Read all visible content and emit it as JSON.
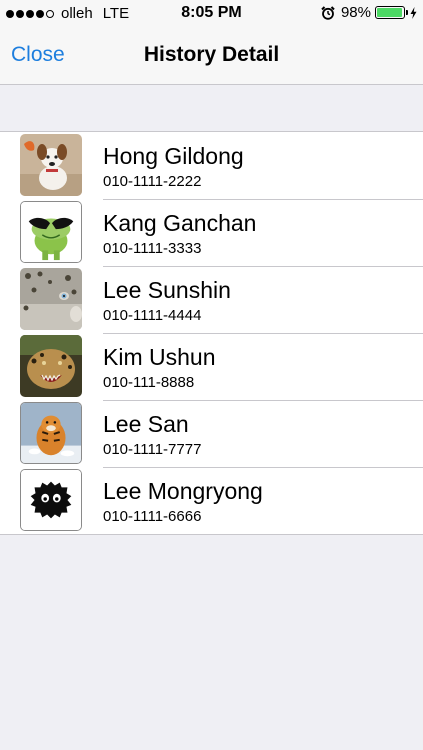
{
  "status_bar": {
    "carrier": "olleh",
    "network": "LTE",
    "signal_bars": 4,
    "signal_max": 5,
    "time": "8:05 PM",
    "battery_percent_text": "98%",
    "battery_level": 0.98,
    "battery_color": "#4cd964",
    "icons": [
      "alarm-icon",
      "battery-icon",
      "charging-icon"
    ]
  },
  "nav": {
    "close_label": "Close",
    "title": "History Detail",
    "accent_color": "#1d7ede"
  },
  "contacts": [
    {
      "name": "Hong Gildong",
      "phone": "010-1111-2222",
      "avatar": "puppy-photo"
    },
    {
      "name": "Kang Ganchan",
      "phone": "010-1111-3333",
      "avatar": "frog-sunglasses-photo"
    },
    {
      "name": "Lee Sunshin",
      "phone": "010-1111-4444",
      "avatar": "leopard-photo"
    },
    {
      "name": "Kim Ushun",
      "phone": "010-111-8888",
      "avatar": "roaring-leopard-photo"
    },
    {
      "name": "Lee San",
      "phone": "010-1111-7777",
      "avatar": "tiger-snow-photo"
    },
    {
      "name": "Lee Mongryong",
      "phone": "010-1111-6666",
      "avatar": "black-fuzzball-photo"
    }
  ]
}
